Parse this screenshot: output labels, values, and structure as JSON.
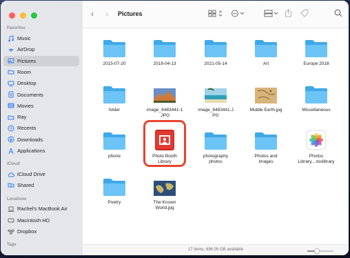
{
  "window": {
    "title": "Pictures",
    "status": "17 items, 696.09 GB available"
  },
  "colors": {
    "close": "#fe5f57",
    "minimize": "#febc2e",
    "zoom": "#28c840",
    "accent": "#2f7cf6",
    "highlight": "#e8432d"
  },
  "sidebar": {
    "favorites_label": "Favorites",
    "favorites": [
      {
        "label": "Music",
        "icon": "music-icon"
      },
      {
        "label": "AirDrop",
        "icon": "airdrop-icon"
      },
      {
        "label": "Pictures",
        "icon": "pictures-icon",
        "active": true
      },
      {
        "label": "Room",
        "icon": "folder-icon"
      },
      {
        "label": "Desktop",
        "icon": "desktop-icon"
      },
      {
        "label": "Documents",
        "icon": "documents-icon"
      },
      {
        "label": "Movies",
        "icon": "movies-icon"
      },
      {
        "label": "Ray",
        "icon": "folder-icon"
      },
      {
        "label": "Recents",
        "icon": "clock-icon"
      },
      {
        "label": "Downloads",
        "icon": "downloads-icon"
      },
      {
        "label": "Applications",
        "icon": "applications-icon"
      }
    ],
    "icloud_label": "iCloud",
    "icloud": [
      {
        "label": "iCloud Drive",
        "icon": "cloud-icon"
      },
      {
        "label": "Shared",
        "icon": "shared-folder-icon"
      }
    ],
    "locations_label": "Locations",
    "locations": [
      {
        "label": "Rachel's MacBook Air",
        "icon": "laptop-icon"
      },
      {
        "label": "Macintosh HD",
        "icon": "disk-icon"
      },
      {
        "label": "Dropbox",
        "icon": "dropbox-icon"
      }
    ],
    "tags_label": "Tags"
  },
  "files": [
    {
      "name": "2015-07-20",
      "kind": "folder"
    },
    {
      "name": "2018-04-13",
      "kind": "folder"
    },
    {
      "name": "2021-05-14",
      "kind": "folder"
    },
    {
      "name": "Art",
      "kind": "folder"
    },
    {
      "name": "Europe 2018",
      "kind": "folder"
    },
    {
      "name": "folder",
      "kind": "folder"
    },
    {
      "name": "image_6483441-1\n.JPG",
      "kind": "image-mountain"
    },
    {
      "name": "image_6483441.J\nPG",
      "kind": "image-beach"
    },
    {
      "name": "Middle Earth.jpg",
      "kind": "image-map"
    },
    {
      "name": "Miscellaneous",
      "kind": "folder"
    },
    {
      "name": "phone",
      "kind": "folder"
    },
    {
      "name": "Photo Booth\nLibrary",
      "kind": "photobooth",
      "highlighted": true
    },
    {
      "name": "photography\nphotos",
      "kind": "folder"
    },
    {
      "name": "Photos and\nImages",
      "kind": "folder"
    },
    {
      "name": "Photos\nLibrary....toslibrary",
      "kind": "photos-app"
    },
    {
      "name": "Poetry",
      "kind": "folder"
    },
    {
      "name": "The Known\nWorld.jpg",
      "kind": "image-world"
    }
  ]
}
